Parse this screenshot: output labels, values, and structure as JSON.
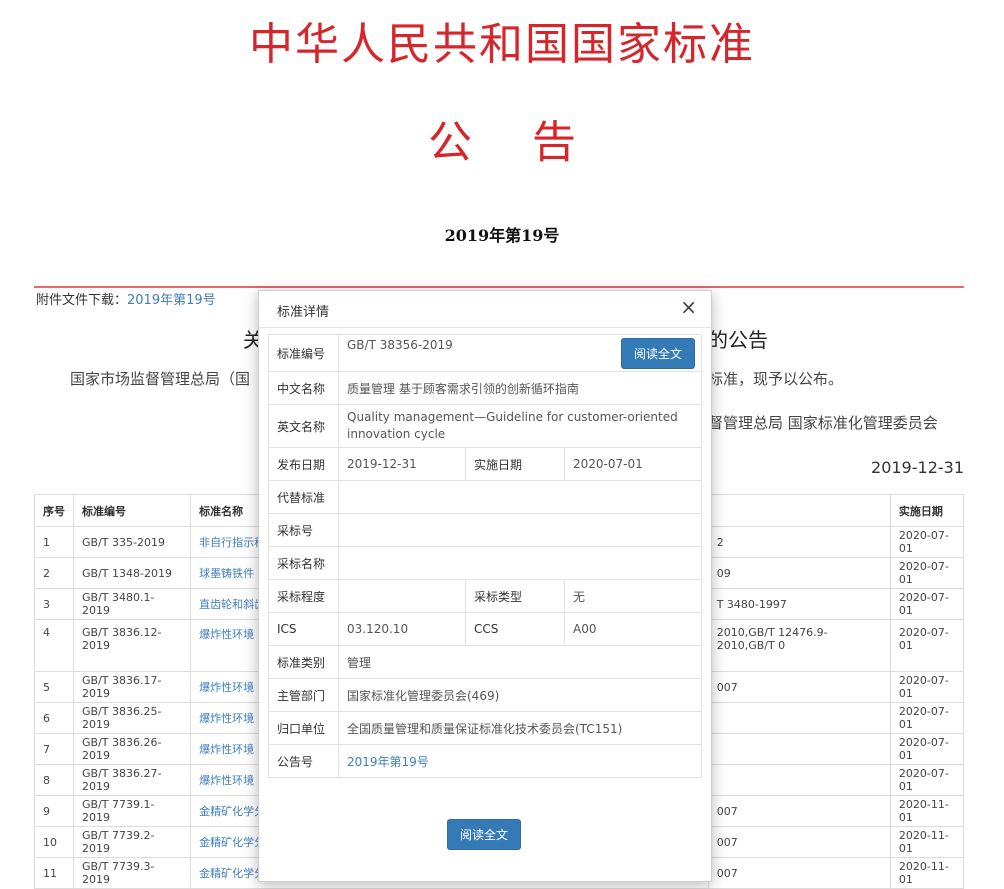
{
  "announcement": {
    "title": "中华人民共和国国家标准",
    "subtitle": "公告",
    "number": "2019年第19号",
    "attachment_label": "附件文件下载：",
    "attachment_link": "2019年第19号",
    "heading_left": "关",
    "heading_right": "的公告",
    "body_left": "国家市场监督管理总局（国",
    "body_right": "标准，现予以公布。",
    "signature": "督管理总局 国家标准化管理委员会",
    "date": "2019-12-31"
  },
  "table": {
    "headers": [
      "序号",
      "标准编号",
      "标准名称",
      "",
      "实施日期"
    ],
    "rows": [
      {
        "seq": "1",
        "code": "GB/T 335-2019",
        "name": "非自行指示秤",
        "replaced": "2",
        "date": "2020-07-01"
      },
      {
        "seq": "2",
        "code": "GB/T 1348-2019",
        "name": "球墨铸铁件",
        "replaced": "09",
        "date": "2020-07-01"
      },
      {
        "seq": "3",
        "code": "GB/T 3480.1-2019",
        "name": "直齿轮和斜齿",
        "replaced": "T 3480-1997",
        "date": "2020-07-01"
      },
      {
        "seq": "4",
        "code": "GB/T 3836.12-2019",
        "name": "爆炸性环境 第",
        "replaced": "2010,GB/T 12476.9-2010,GB/T 0",
        "date": "2020-07-01"
      },
      {
        "seq": "5",
        "code": "GB/T 3836.17-2019",
        "name": "爆炸性环境 第",
        "replaced": "007",
        "date": "2020-07-01"
      },
      {
        "seq": "6",
        "code": "GB/T 3836.25-2019",
        "name": "爆炸性环境 第",
        "replaced": "",
        "date": "2020-07-01"
      },
      {
        "seq": "7",
        "code": "GB/T 3836.26-2019",
        "name": "爆炸性环境 第",
        "replaced": "",
        "date": "2020-07-01"
      },
      {
        "seq": "8",
        "code": "GB/T 3836.27-2019",
        "name": "爆炸性环境 第",
        "replaced": "",
        "date": "2020-07-01"
      },
      {
        "seq": "9",
        "code": "GB/T 7739.1-2019",
        "name": "金精矿化学分",
        "replaced": "007",
        "date": "2020-11-01"
      },
      {
        "seq": "10",
        "code": "GB/T 7739.2-2019",
        "name": "金精矿化学分",
        "replaced": "007",
        "date": "2020-11-01"
      },
      {
        "seq": "11",
        "code": "GB/T 7739.3-2019",
        "name": "金精矿化学分",
        "replaced": "007",
        "date": "2020-11-01"
      }
    ]
  },
  "modal": {
    "title": "标准详情",
    "close_glyph": "×",
    "read_full_label": "阅读全文",
    "fields": {
      "code_label": "标准编号",
      "code_value": "GB/T 38356-2019",
      "cn_name_label": "中文名称",
      "cn_name_value": "质量管理 基于顾客需求引领的创新循环指南",
      "en_name_label": "英文名称",
      "en_name_value": "Quality management—Guideline for customer-oriented innovation cycle",
      "publish_label": "发布日期",
      "publish_value": "2019-12-31",
      "impl_label": "实施日期",
      "impl_value": "2020-07-01",
      "replace_label": "代替标准",
      "replace_value": "",
      "adopt_no_label": "采标号",
      "adopt_no_value": "",
      "adopt_name_label": "采标名称",
      "adopt_name_value": "",
      "adopt_degree_label": "采标程度",
      "adopt_degree_value": "",
      "adopt_type_label": "采标类型",
      "adopt_type_value": "无",
      "ics_label": "ICS",
      "ics_value": "03.120.10",
      "ccs_label": "CCS",
      "ccs_value": "A00",
      "category_label": "标准类别",
      "category_value": "管理",
      "dept_label": "主管部门",
      "dept_value": "国家标准化管理委员会(469)",
      "unit_label": "归口单位",
      "unit_value": "全国质量管理和质量保证标准化技术委员会(TC151)",
      "notice_label": "公告号",
      "notice_value": "2019年第19号"
    }
  },
  "colors": {
    "title_red": "#d7262b",
    "link_blue": "#3f7fbf",
    "button_blue": "#337ab7"
  }
}
